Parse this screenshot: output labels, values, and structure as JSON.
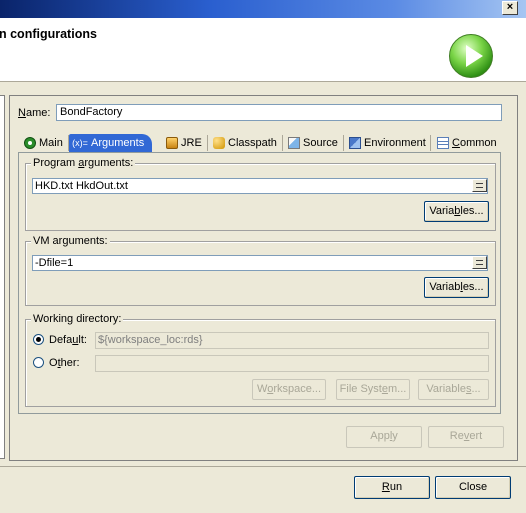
{
  "window": {
    "close_glyph": "×"
  },
  "header": {
    "title_partial": "n configurations",
    "badge_icon": "run-icon"
  },
  "name": {
    "label_u": "N",
    "label_rest": "ame:",
    "value": "BondFactory"
  },
  "tabs": [
    {
      "id": "main",
      "label": "Main",
      "icon": "main-class-icon",
      "active": false
    },
    {
      "id": "arguments",
      "label": "Arguments",
      "icon": "arguments-icon",
      "active": true,
      "icon_glyph": "(x)="
    },
    {
      "id": "jre",
      "label": "JRE",
      "icon": "jre-icon",
      "active": false
    },
    {
      "id": "classpath",
      "label": "Classpath",
      "icon": "classpath-icon",
      "active": false
    },
    {
      "id": "source",
      "label": "Source",
      "icon": "source-icon",
      "active": false
    },
    {
      "id": "environment",
      "label": "Environment",
      "icon": "environment-icon",
      "active": false
    },
    {
      "id": "common",
      "label_u": "C",
      "label_rest": "ommon",
      "icon": "common-icon",
      "active": false
    }
  ],
  "program_args": {
    "label_pre": "Program ",
    "label_u": "a",
    "label_post": "rguments:",
    "value": "HKD.txt HkdOut.txt",
    "variables_pre": "Varia",
    "variables_u": "b",
    "variables_post": "les..."
  },
  "vm_args": {
    "label_pre": "VM ar",
    "label_u": "g",
    "label_post": "uments:",
    "value": "-Dfile=1",
    "variables_pre": "Variab",
    "variables_u": "l",
    "variables_post": "es..."
  },
  "working_dir": {
    "label": "Working directory:",
    "default_pre": "Defa",
    "default_u": "u",
    "default_post": "lt:",
    "default_value": "${workspace_loc:rds}",
    "other_pre": "O",
    "other_u": "t",
    "other_post": "her:",
    "other_value": "",
    "workspace_pre": "W",
    "workspace_u": "o",
    "workspace_post": "rkspace...",
    "filesystem_pre": "File Syst",
    "filesystem_u": "e",
    "filesystem_post": "m...",
    "variables_pre": "Variable",
    "variables_u": "s",
    "variables_post": "..."
  },
  "buttons": {
    "apply_pre": "App",
    "apply_u": "l",
    "apply_post": "y",
    "revert_pre": "Re",
    "revert_u": "v",
    "revert_post": "ert",
    "run_u": "R",
    "run_rest": "un",
    "close": "Close"
  },
  "colors": {
    "accent": "#3168d5",
    "title_bar": "#0a246a",
    "face": "#ece9d8"
  }
}
